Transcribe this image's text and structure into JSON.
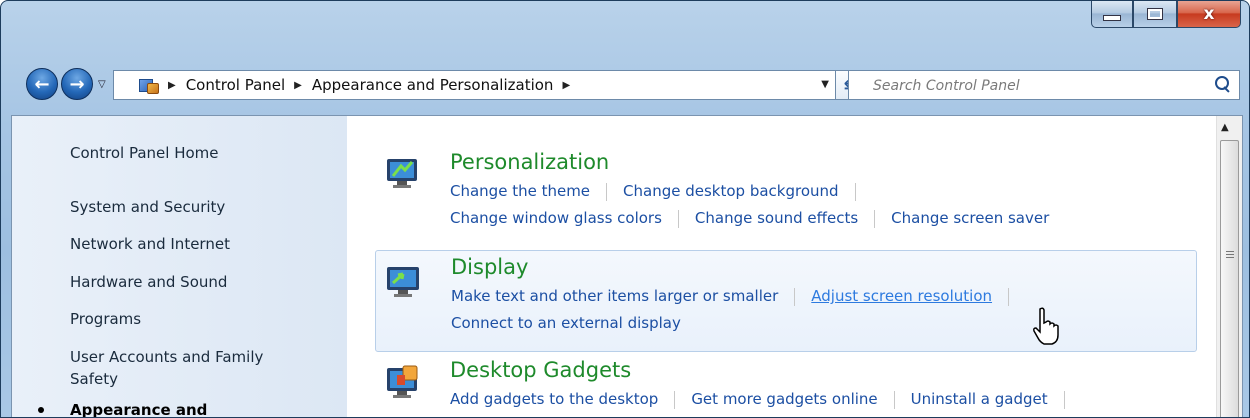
{
  "window": {
    "caption": {
      "minimize_icon": "minimize-icon",
      "maximize_icon": "maximize-icon",
      "close_glyph": "x"
    }
  },
  "navigation": {
    "back_icon": "back-arrow-icon",
    "forward_icon": "forward-arrow-icon",
    "breadcrumbs": [
      "Control Panel",
      "Appearance and Personalization"
    ],
    "search_placeholder": "Search Control Panel"
  },
  "sidebar": {
    "items": [
      {
        "label": "Control Panel Home"
      },
      {
        "label": "System and Security"
      },
      {
        "label": "Network and Internet"
      },
      {
        "label": "Hardware and Sound"
      },
      {
        "label": "Programs"
      },
      {
        "label": "User Accounts and Family Safety"
      },
      {
        "label": "Appearance and"
      }
    ]
  },
  "categories": [
    {
      "title": "Personalization",
      "icon": "personalization-icon",
      "links": [
        "Change the theme",
        "Change desktop background",
        "Change window glass colors",
        "Change sound effects",
        "Change screen saver"
      ]
    },
    {
      "title": "Display",
      "icon": "display-icon",
      "links": [
        "Make text and other items larger or smaller",
        "Adjust screen resolution",
        "Connect to an external display"
      ]
    },
    {
      "title": "Desktop Gadgets",
      "icon": "gadgets-icon",
      "links": [
        "Add gadgets to the desktop",
        "Get more gadgets online",
        "Uninstall a gadget"
      ]
    }
  ],
  "colors": {
    "category_title": "#1e8a2b",
    "link": "#1c4fa3",
    "link_hover": "#2d7adf"
  }
}
